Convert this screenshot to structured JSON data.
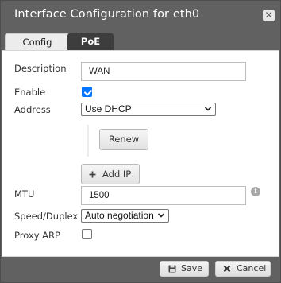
{
  "dialog": {
    "title": "Interface Configuration for eth0",
    "close_glyph": "✕"
  },
  "tabs": [
    {
      "label": "Config",
      "active": true
    },
    {
      "label": "PoE",
      "active": false
    }
  ],
  "form": {
    "description": {
      "label": "Description",
      "value": "WAN"
    },
    "enable": {
      "label": "Enable",
      "checked": true
    },
    "address": {
      "label": "Address",
      "selected": "Use DHCP"
    },
    "renew_button": "Renew",
    "add_ip_button": "Add IP",
    "mtu": {
      "label": "MTU",
      "value": "1500"
    },
    "speed_duplex": {
      "label": "Speed/Duplex",
      "selected": "Auto negotiation"
    },
    "proxy_arp": {
      "label": "Proxy ARP",
      "checked": false
    }
  },
  "footer": {
    "save_label": "Save",
    "cancel_label": "Cancel"
  },
  "icons": {
    "info": "info-icon",
    "save": "floppy-disk-icon",
    "cancel": "x-icon",
    "add": "plus-icon"
  },
  "colors": {
    "chrome": "#616161",
    "checkbox_checked": "#0075ff"
  }
}
